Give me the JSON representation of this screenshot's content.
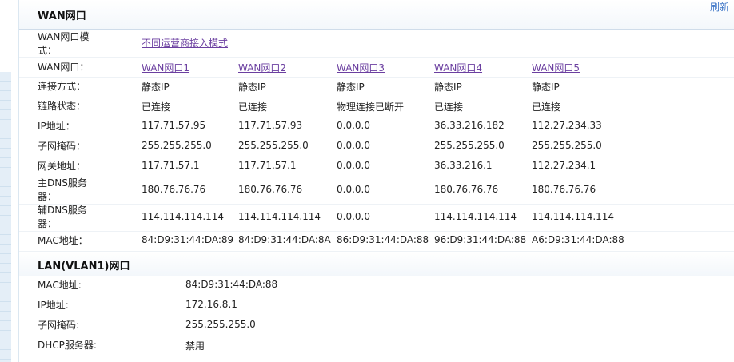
{
  "toolbar": {
    "refresh": "刷新"
  },
  "wan": {
    "title": "WAN网口",
    "mode_label": "WAN网口模式：",
    "mode_value": "不同运营商接入模式",
    "port_label": "WAN网口：",
    "ports": [
      "WAN网口1",
      "WAN网口2",
      "WAN网口3",
      "WAN网口4",
      "WAN网口5"
    ],
    "rows": [
      {
        "label": "连接方式：",
        "values": [
          "静态IP",
          "静态IP",
          "静态IP",
          "静态IP",
          "静态IP"
        ]
      },
      {
        "label": "链路状态：",
        "values": [
          "已连接",
          "已连接",
          "物理连接已断开",
          "已连接",
          "已连接"
        ]
      },
      {
        "label": "IP地址：",
        "values": [
          "117.71.57.95",
          "117.71.57.93",
          "0.0.0.0",
          "36.33.216.182",
          "112.27.234.33"
        ]
      },
      {
        "label": "子网掩码：",
        "values": [
          "255.255.255.0",
          "255.255.255.0",
          "0.0.0.0",
          "255.255.255.0",
          "255.255.255.0"
        ]
      },
      {
        "label": "网关地址：",
        "values": [
          "117.71.57.1",
          "117.71.57.1",
          "0.0.0.0",
          "36.33.216.1",
          "112.27.234.1"
        ]
      },
      {
        "label": "主DNS服务器：",
        "values": [
          "180.76.76.76",
          "180.76.76.76",
          "0.0.0.0",
          "180.76.76.76",
          "180.76.76.76"
        ]
      },
      {
        "label": "辅DNS服务器：",
        "values": [
          "114.114.114.114",
          "114.114.114.114",
          "0.0.0.0",
          "114.114.114.114",
          "114.114.114.114"
        ]
      },
      {
        "label": "MAC地址：",
        "values": [
          "84:D9:31:44:DA:89",
          "84:D9:31:44:DA:8A",
          "86:D9:31:44:DA:88",
          "96:D9:31:44:DA:88",
          "A6:D9:31:44:DA:88"
        ]
      }
    ]
  },
  "lan": {
    "title": "LAN(VLAN1)网口",
    "rows": [
      {
        "label": "MAC地址:",
        "value": "84:D9:31:44:DA:88"
      },
      {
        "label": "IP地址:",
        "value": "172.16.8.1"
      },
      {
        "label": "子网掩码:",
        "value": "255.255.255.0"
      },
      {
        "label": "DHCP服务器:",
        "value": "禁用"
      }
    ]
  }
}
